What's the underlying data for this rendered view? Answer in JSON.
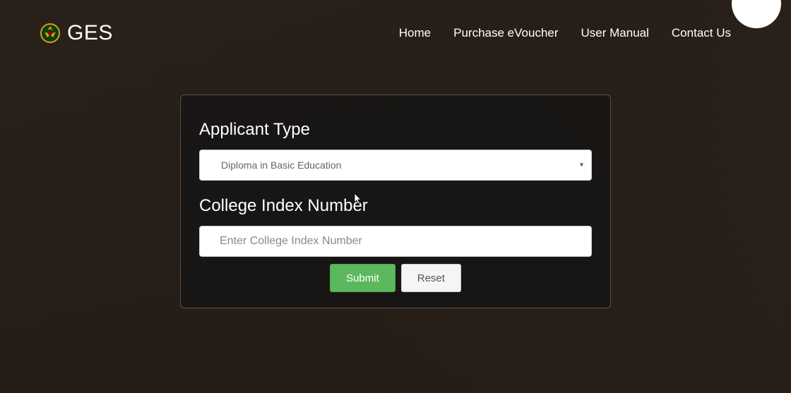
{
  "brand": {
    "name": "GES"
  },
  "nav": {
    "home": "Home",
    "purchase": "Purchase eVoucher",
    "manual": "User Manual",
    "contact": "Contact Us"
  },
  "form": {
    "applicant_type_label": "Applicant Type",
    "applicant_type_value": "Diploma in Basic Education",
    "college_index_label": "College Index Number",
    "college_index_placeholder": "Enter College Index Number",
    "submit_label": "Submit",
    "reset_label": "Reset"
  }
}
